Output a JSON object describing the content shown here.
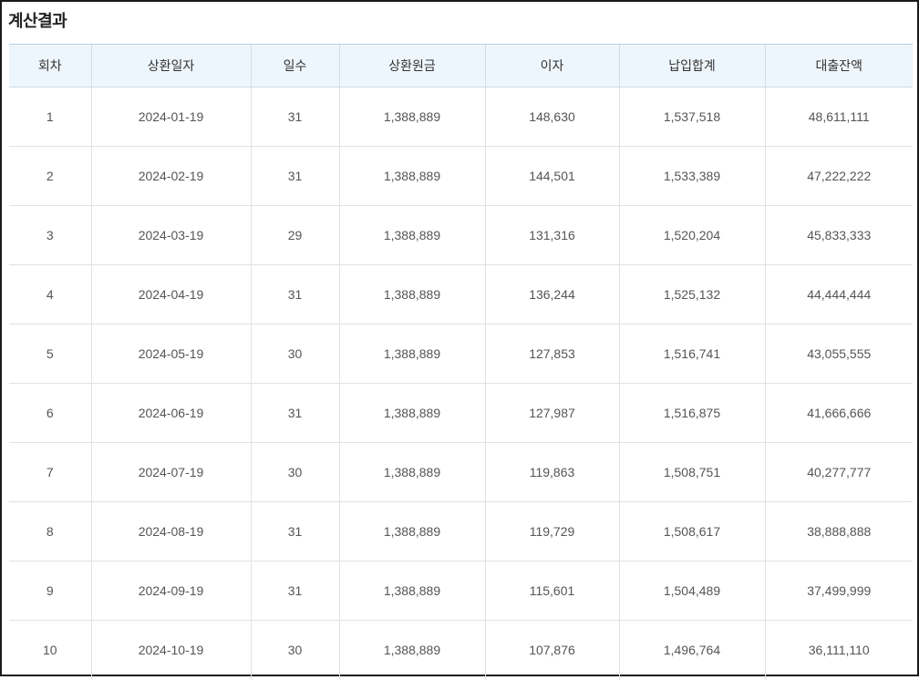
{
  "title": "계산결과",
  "table": {
    "headers": [
      "회차",
      "상환일자",
      "일수",
      "상환원금",
      "이자",
      "납입합계",
      "대출잔액"
    ],
    "rows": [
      [
        "1",
        "2024-01-19",
        "31",
        "1,388,889",
        "148,630",
        "1,537,518",
        "48,611,111"
      ],
      [
        "2",
        "2024-02-19",
        "31",
        "1,388,889",
        "144,501",
        "1,533,389",
        "47,222,222"
      ],
      [
        "3",
        "2024-03-19",
        "29",
        "1,388,889",
        "131,316",
        "1,520,204",
        "45,833,333"
      ],
      [
        "4",
        "2024-04-19",
        "31",
        "1,388,889",
        "136,244",
        "1,525,132",
        "44,444,444"
      ],
      [
        "5",
        "2024-05-19",
        "30",
        "1,388,889",
        "127,853",
        "1,516,741",
        "43,055,555"
      ],
      [
        "6",
        "2024-06-19",
        "31",
        "1,388,889",
        "127,987",
        "1,516,875",
        "41,666,666"
      ],
      [
        "7",
        "2024-07-19",
        "30",
        "1,388,889",
        "119,863",
        "1,508,751",
        "40,277,777"
      ],
      [
        "8",
        "2024-08-19",
        "31",
        "1,388,889",
        "119,729",
        "1,508,617",
        "38,888,888"
      ],
      [
        "9",
        "2024-09-19",
        "31",
        "1,388,889",
        "115,601",
        "1,504,489",
        "37,499,999"
      ],
      [
        "10",
        "2024-10-19",
        "30",
        "1,388,889",
        "107,876",
        "1,496,764",
        "36,111,110"
      ]
    ]
  }
}
